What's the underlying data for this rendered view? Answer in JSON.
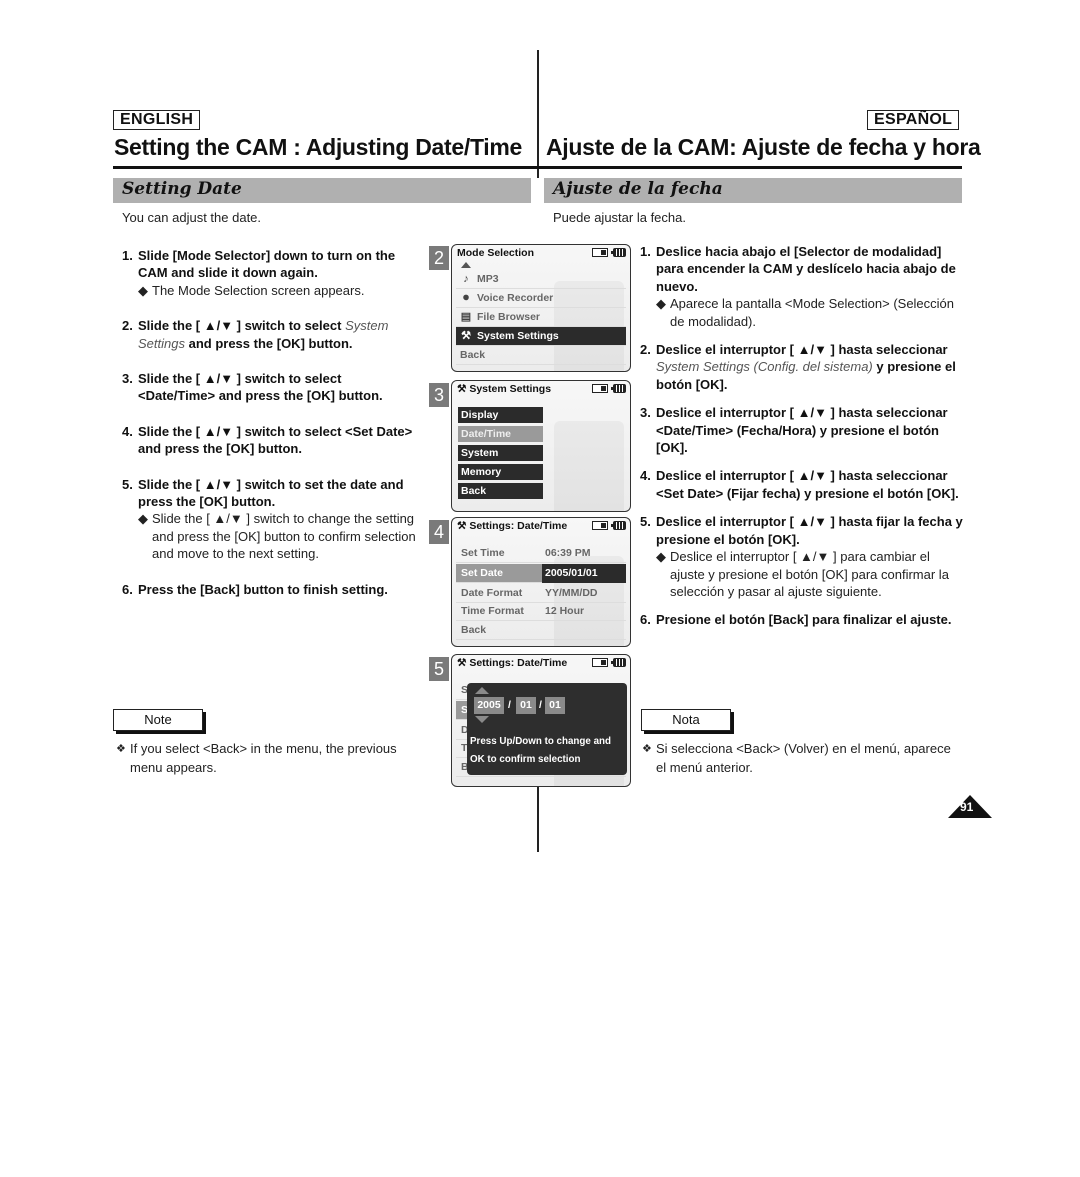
{
  "header": {
    "lang_en": "ENGLISH",
    "lang_es": "ESPAÑOL",
    "title_en": "Setting the CAM : Adjusting Date/Time",
    "title_es": "Ajuste de la CAM: Ajuste de fecha y hora"
  },
  "section": {
    "en": "Setting Date",
    "es": "Ajuste de la fecha"
  },
  "intro": {
    "en": "You can adjust the date.",
    "es": "Puede ajustar la fecha."
  },
  "steps_en": [
    {
      "num": "1.",
      "main": "Slide [Mode Selector] down to turn on the CAM and slide it down again.",
      "sub": "The Mode Selection screen appears."
    },
    {
      "num": "2.",
      "main_pre": "Slide the [ ▲/▼ ] switch to select ",
      "main_italic": "System Settings",
      "main_post": " and press the [OK] button."
    },
    {
      "num": "3.",
      "main": "Slide the [ ▲/▼ ] switch to select <Date/Time> and press the [OK] button."
    },
    {
      "num": "4.",
      "main": "Slide the [ ▲/▼ ] switch to select <Set Date> and press the [OK] button."
    },
    {
      "num": "5.",
      "main": "Slide the [ ▲/▼ ] switch to set the date and press the [OK] button.",
      "sub": "Slide the [ ▲/▼ ] switch to change the setting and press the [OK] button to confirm selection and move to the next setting."
    },
    {
      "num": "6.",
      "main": "Press the [Back] button to finish setting."
    }
  ],
  "steps_es": [
    {
      "num": "1.",
      "main": "Deslice hacia abajo el [Selector de modalidad] para encender la CAM y deslícelo hacia abajo de nuevo.",
      "sub": "Aparece la pantalla <Mode Selection> (Selección de modalidad)."
    },
    {
      "num": "2.",
      "main_pre": "Deslice el interruptor [ ▲/▼ ] hasta seleccionar ",
      "main_italic": "System Settings (Config. del sistema)",
      "main_post": " y presione el botón [OK]."
    },
    {
      "num": "3.",
      "main": "Deslice el interruptor [ ▲/▼ ] hasta seleccionar <Date/Time> (Fecha/Hora) y presione el botón [OK]."
    },
    {
      "num": "4.",
      "main": "Deslice el interruptor [ ▲/▼ ] hasta seleccionar <Set Date> (Fijar fecha) y presione el botón [OK]."
    },
    {
      "num": "5.",
      "main": "Deslice el interruptor [ ▲/▼ ] hasta fijar la fecha y presione el botón [OK].",
      "sub": "Deslice el interruptor [ ▲/▼ ] para cambiar el ajuste y presione el botón [OK] para confirmar la selección y pasar al ajuste siguiente."
    },
    {
      "num": "6.",
      "main": "Presione el botón [Back] para finalizar el ajuste."
    }
  ],
  "note": {
    "label_en": "Note",
    "label_es": "Nota",
    "text_en": "If you select <Back> in the menu, the previous menu appears.",
    "text_es": "Si selecciona <Back> (Volver) en el menú, aparece el menú anterior.",
    "bullet": "❖"
  },
  "screens": {
    "s2": {
      "num": "2",
      "title": "Mode Selection",
      "items": [
        {
          "icon": "♪",
          "label": "MP3"
        },
        {
          "icon": "🎙",
          "label": "Voice Recorder"
        },
        {
          "icon": "▤",
          "label": "File Browser"
        },
        {
          "icon": "⚙",
          "label": "System Settings",
          "selected": true
        },
        {
          "icon": "",
          "label": "Back"
        }
      ]
    },
    "s3": {
      "num": "3",
      "title": "System Settings",
      "items": [
        "Display",
        "Date/Time",
        "System",
        "Memory",
        "Back"
      ],
      "selected_index": 1
    },
    "s4": {
      "num": "4",
      "title": "Settings: Date/Time",
      "rows": [
        {
          "key": "Set Time",
          "value": "06:39 PM"
        },
        {
          "key": "Set Date",
          "value": "2005/01/01",
          "selected": true
        },
        {
          "key": "Date Format",
          "value": "YY/MM/DD"
        },
        {
          "key": "Time Format",
          "value": "12 Hour"
        },
        {
          "key": "Back",
          "value": ""
        }
      ]
    },
    "s5": {
      "num": "5",
      "title": "Settings: Date/Time",
      "year": "2005",
      "month": "01",
      "day": "01",
      "sep": "/",
      "msg1": "Press Up/Down to change and",
      "msg2": "OK to confirm selection",
      "bg_letters": [
        "S",
        "S",
        "D",
        "T",
        "B"
      ]
    }
  },
  "page_number": "91"
}
